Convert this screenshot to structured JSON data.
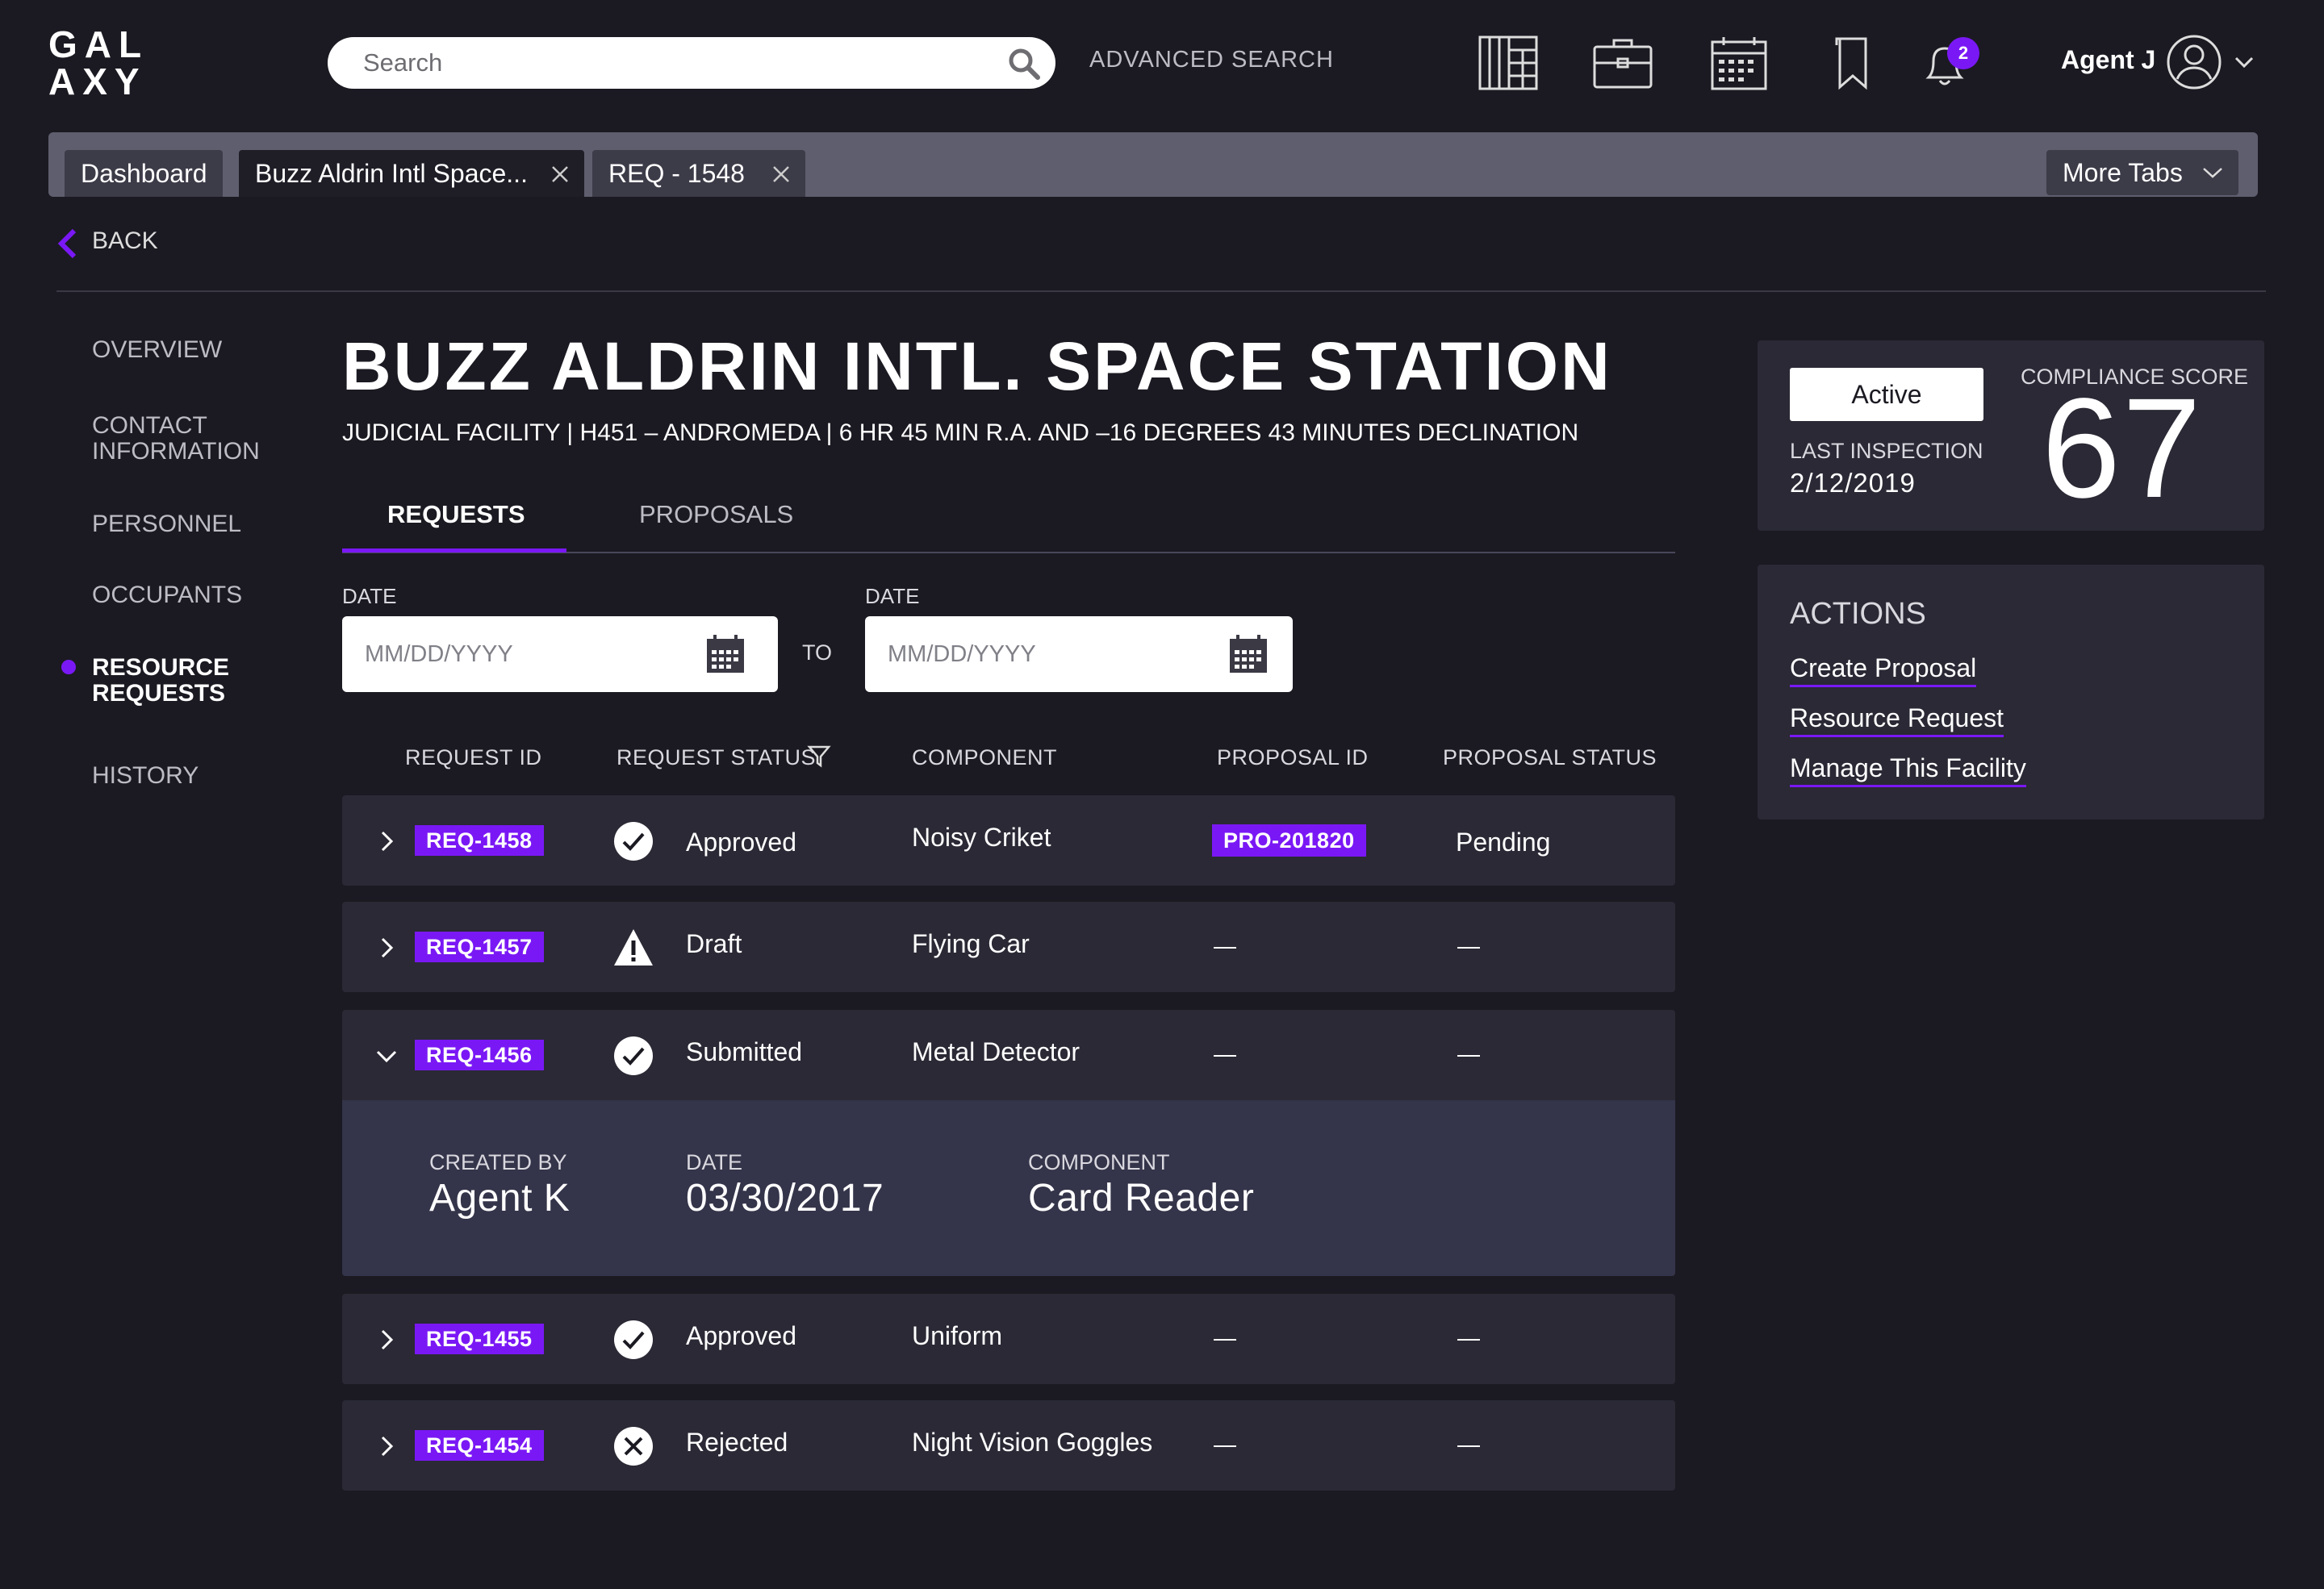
{
  "header": {
    "logo_line1": "GAL",
    "logo_line2": "AXY",
    "search_placeholder": "Search",
    "advanced_search": "ADVANCED SEARCH",
    "notification_count": "2",
    "user_name": "Agent J",
    "icons": [
      "building-grid-icon",
      "briefcase-icon",
      "calendar-icon",
      "bookmark-icon",
      "bell-icon",
      "user-avatar-icon"
    ]
  },
  "tabs": {
    "dashboard": "Dashboard",
    "facility": "Buzz Aldrin Intl Space...",
    "request": "REQ - 1548",
    "more": "More Tabs"
  },
  "back_label": "BACK",
  "nav": {
    "overview": "OVERVIEW",
    "contact_1": "CONTACT",
    "contact_2": "INFORMATION",
    "personnel": "PERSONNEL",
    "occupants": "OCCUPANTS",
    "resource_1": "RESOURCE",
    "resource_2": "REQUESTS",
    "history": "HISTORY"
  },
  "facility": {
    "title": "BUZZ ALDRIN INTL. SPACE STATION",
    "subtitle": "JUDICIAL FACILITY  |  H451 – ANDROMEDA  | 6 HR 45 MIN R.A. AND –16 DEGREES 43 MINUTES DECLINATION"
  },
  "main_tabs": {
    "requests": "REQUESTS",
    "proposals": "PROPOSALS"
  },
  "filter": {
    "date_label": "DATE",
    "date_placeholder": "MM/DD/YYYY",
    "to_label": "TO"
  },
  "table": {
    "headers": {
      "request_id": "REQUEST ID",
      "request_status": "REQUEST STATUS",
      "component": "COMPONENT",
      "proposal_id": "PROPOSAL ID",
      "proposal_status": "PROPOSAL STATUS"
    },
    "rows": [
      {
        "id": "REQ-1458",
        "status": "Approved",
        "component": "Noisy Criket",
        "proposal_id": "PRO-201820",
        "proposal_status": "Pending"
      },
      {
        "id": "REQ-1457",
        "status": "Draft",
        "component": "Flying Car"
      },
      {
        "id": "REQ-1456",
        "status": "Submitted",
        "component": "Metal Detector"
      },
      {
        "id": "REQ-1455",
        "status": "Approved",
        "component": "Uniform"
      },
      {
        "id": "REQ-1454",
        "status": "Rejected",
        "component": "Night Vision Goggles"
      }
    ],
    "detail": {
      "created_by_label": "CREATED BY",
      "created_by": "Agent K",
      "date_label": "DATE",
      "date": "03/30/2017",
      "component_label": "COMPONENT",
      "component": "Card Reader"
    }
  },
  "summary": {
    "status": "Active",
    "last_inspection_label": "LAST INSPECTION",
    "last_inspection": "2/12/2019",
    "compliance_label": "COMPLIANCE SCORE",
    "compliance_score": "67"
  },
  "actions": {
    "title": "ACTIONS",
    "links": [
      "Create Proposal",
      "Resource Request",
      "Manage This Facility"
    ]
  },
  "colors": {
    "accent": "#7a18f5",
    "background": "#1b1a22",
    "row": "#2a2935",
    "detail": "#34344a"
  }
}
